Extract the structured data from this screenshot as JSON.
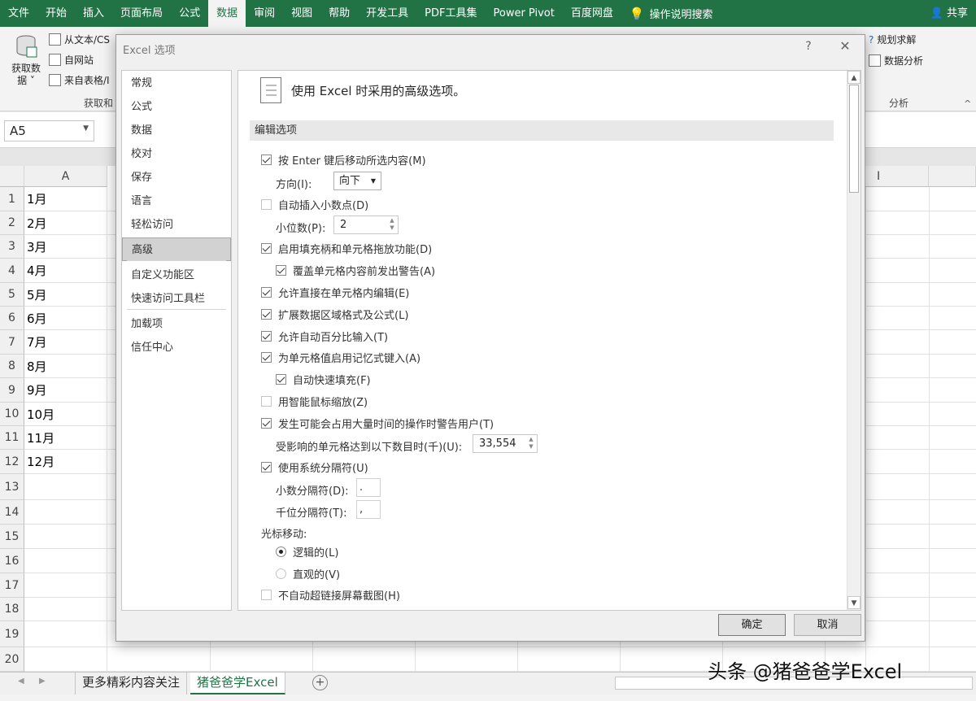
{
  "ribbon": {
    "tabs": [
      {
        "label": "文件"
      },
      {
        "label": "开始"
      },
      {
        "label": "插入"
      },
      {
        "label": "页面布局"
      },
      {
        "label": "公式"
      },
      {
        "label": "数据",
        "active": true
      },
      {
        "label": "审阅"
      },
      {
        "label": "视图"
      },
      {
        "label": "帮助"
      },
      {
        "label": "开发工具"
      },
      {
        "label": "PDF工具集"
      },
      {
        "label": "Power Pivot"
      },
      {
        "label": "百度网盘"
      }
    ],
    "search_label": "操作说明搜索",
    "share_label": "共享",
    "get_data_line1": "获取数",
    "get_data_line2": "据",
    "from_text": "从文本/CS",
    "from_web": "自网站",
    "from_table": "来自表格/I",
    "group_get": "获取和",
    "solver": "规划求解",
    "data_analysis": "数据分析",
    "group_analysis": "分析"
  },
  "formula_bar": {
    "name_box": "A5"
  },
  "sheet": {
    "column_a": "A",
    "column_i": "I",
    "rows": [
      "1",
      "2",
      "3",
      "4",
      "5",
      "6",
      "7",
      "8",
      "9",
      "10",
      "11",
      "12",
      "13",
      "14",
      "15",
      "16",
      "17",
      "18",
      "19",
      "20"
    ],
    "cells": [
      "1月",
      "2月",
      "3月",
      "4月",
      "5月",
      "6月",
      "7月",
      "8月",
      "9月",
      "10月",
      "11月",
      "12月"
    ]
  },
  "sheet_tabs": [
    {
      "label": "更多精彩内容关注"
    },
    {
      "label": "猪爸爸学Excel",
      "active": true
    }
  ],
  "dialog": {
    "title": "Excel 选项",
    "help": "?",
    "close": "✕",
    "nav": [
      "常规",
      "公式",
      "数据",
      "校对",
      "保存",
      "语言",
      "轻松访问",
      "高级",
      "自定义功能区",
      "快速访问工具栏",
      "加载项",
      "信任中心"
    ],
    "selected_nav": "高级",
    "header": "使用 Excel 时采用的高级选项。",
    "section": "编辑选项",
    "options": {
      "move_after_enter": "按 Enter 键后移动所选内容(M)",
      "direction_label": "方向(I):",
      "direction_value": "向下",
      "auto_decimal": "自动插入小数点(D)",
      "places_label": "小位数(P):",
      "places_value": "2",
      "fill_handle": "启用填充柄和单元格拖放功能(D)",
      "overwrite_alert": "覆盖单元格内容前发出警告(A)",
      "edit_in_cell": "允许直接在单元格内编辑(E)",
      "extend_formats": "扩展数据区域格式及公式(L)",
      "auto_percent": "允许自动百分比输入(T)",
      "autocomplete": "为单元格值启用记忆式键入(A)",
      "flash_fill": "自动快速填充(F)",
      "intellimouse": "用智能鼠标缩放(Z)",
      "alert_slow": "发生可能会占用大量时间的操作时警告用户(T)",
      "cells_label": "受影响的单元格达到以下数目时(千)(U):",
      "cells_value": "33,554",
      "system_sep": "使用系统分隔符(U)",
      "decimal_sep_label": "小数分隔符(D):",
      "decimal_sep_value": ".",
      "thousands_sep_label": "千位分隔符(T):",
      "thousands_sep_value": ",",
      "cursor_label": "光标移动:",
      "logical": "逻辑的(L)",
      "visual": "直观的(V)",
      "no_hyperlink": "不自动超链接屏幕截图(H)"
    },
    "ok": "确定",
    "cancel": "取消"
  },
  "watermark": "头条 @猪爸爸学Excel"
}
